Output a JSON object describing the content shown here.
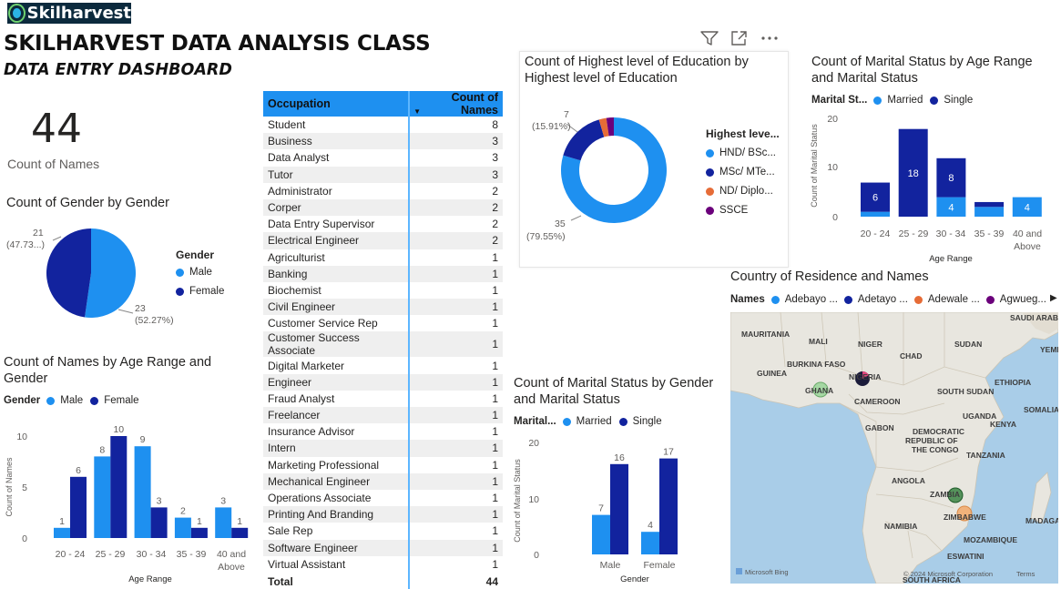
{
  "header": {
    "logo_text": "Skilharvest",
    "title": "SKILHARVEST DATA ANALYSIS CLASS",
    "subtitle": "DATA ENTRY DASHBOARD"
  },
  "colors": {
    "light_blue": "#1e90f0",
    "dark_blue": "#12239e",
    "orange": "#e66c37",
    "purple": "#6b007b",
    "header_blue": "#1e90f0"
  },
  "card": {
    "value": "44",
    "label": "Count of Names"
  },
  "gender_pie": {
    "title": "Count of Gender by Gender",
    "legend_title": "Gender",
    "legend": [
      "Male",
      "Female"
    ],
    "label_female_value": "21",
    "label_female_pct": "(47.73...)",
    "label_male_value": "23",
    "label_male_pct": "(52.27%)"
  },
  "age_gender_chart": {
    "title_line1": "Count of Names by Age Range and",
    "title_line2": "Gender",
    "legend_title": "Gender",
    "legend": [
      "Male",
      "Female"
    ],
    "xlabel": "Age Range",
    "ylabel": "Count of Names",
    "ticks": [
      "0",
      "5",
      "10"
    ],
    "categories": [
      "20 - 24",
      "25 - 29",
      "30 - 34",
      "35 - 39",
      "40 and",
      "Above"
    ]
  },
  "occupation_table": {
    "col1": "Occupation",
    "col2": "Count of Names",
    "rows": [
      [
        "Student",
        "8"
      ],
      [
        "Business",
        "3"
      ],
      [
        "Data Analyst",
        "3"
      ],
      [
        "Tutor",
        "3"
      ],
      [
        "Administrator",
        "2"
      ],
      [
        "Corper",
        "2"
      ],
      [
        "Data Entry Supervisor",
        "2"
      ],
      [
        "Electrical Engineer",
        "2"
      ],
      [
        "Agriculturist",
        "1"
      ],
      [
        "Banking",
        "1"
      ],
      [
        "Biochemist",
        "1"
      ],
      [
        "Civil Engineer",
        "1"
      ],
      [
        "Customer Service Rep",
        "1"
      ],
      [
        "Customer Success Associate",
        "1"
      ],
      [
        "Digital Marketer",
        "1"
      ],
      [
        "Engineer",
        "1"
      ],
      [
        "Fraud Analyst",
        "1"
      ],
      [
        "Freelancer",
        "1"
      ],
      [
        "Insurance Advisor",
        "1"
      ],
      [
        "Intern",
        "1"
      ],
      [
        "Marketing Professional",
        "1"
      ],
      [
        "Mechanical Engineer",
        "1"
      ],
      [
        "Operations Associate",
        "1"
      ],
      [
        "Printing And Branding",
        "1"
      ],
      [
        "Sale Rep",
        "1"
      ],
      [
        "Software Engineer",
        "1"
      ],
      [
        "Virtual Assistant",
        "1"
      ]
    ],
    "total_label": "Total",
    "total_value": "44"
  },
  "education_donut": {
    "title_line1": "Count of Highest level of Education by",
    "title_line2": "Highest level of Education",
    "legend_title": "Highest leve...",
    "legend": [
      "HND/ BSc...",
      "MSc/ MTe...",
      "ND/ Diplo...",
      "SSCE"
    ],
    "label_top_value": "7",
    "label_top_pct": "(15.91%)",
    "label_bottom_value": "35",
    "label_bottom_pct": "(79.55%)"
  },
  "marital_age_chart": {
    "title_line1": "Count of Marital Status by Age Range",
    "title_line2": "and Marital Status",
    "legend_title": "Marital St...",
    "legend": [
      "Married",
      "Single"
    ],
    "xlabel": "Age Range",
    "ylabel": "Count of Marital Status",
    "ticks": [
      "0",
      "10",
      "20"
    ],
    "categories": [
      "20 - 24",
      "25 - 29",
      "30 - 34",
      "35 - 39",
      "40 and",
      "Above"
    ]
  },
  "marital_gender_chart": {
    "title_line1": "Count of Marital Status by Gender",
    "title_line2": "and Marital Status",
    "legend_title": "Marital...",
    "legend": [
      "Married",
      "Single"
    ],
    "xlabel": "Gender",
    "ylabel": "Count of Marital Status",
    "ticks": [
      "0",
      "10",
      "20"
    ],
    "categories": [
      "Male",
      "Female"
    ]
  },
  "map": {
    "title": "Country of Residence and Names",
    "legend_title": "Names",
    "legend": [
      "Adebayo ...",
      "Adetayo ...",
      "Adewale ...",
      "Agwueg..."
    ],
    "countries": [
      "MAURITANIA",
      "MALI",
      "NIGER",
      "CHAD",
      "SUDAN",
      "SAUDI ARAB",
      "YEMEN",
      "BURKINA FASO",
      "GUINEA",
      "GHANA",
      "NIGERIA",
      "CAMEROON",
      "SOUTH SUDAN",
      "ETHIOPIA",
      "SOMALIA",
      "UGANDA",
      "KENYA",
      "GABON",
      "DEMOCRATIC",
      "REPUBLIC OF",
      "THE CONGO",
      "TANZANIA",
      "ANGOLA",
      "ZAMBIA",
      "ZIMBABWE",
      "NAMIBIA",
      "MOZAMBIQUE",
      "MADAGASC",
      "ESWATINI",
      "SOUTH AFRICA"
    ],
    "attribution": "Microsoft Bing",
    "copyright": "© 2024 Microsoft Corporation",
    "terms": "Terms"
  },
  "chart_data": [
    {
      "type": "pie",
      "title": "Count of Gender by Gender",
      "categories": [
        "Male",
        "Female"
      ],
      "values": [
        23,
        21
      ]
    },
    {
      "type": "bar",
      "title": "Count of Names by Age Range and Gender",
      "xlabel": "Age Range",
      "ylabel": "Count of Names",
      "categories": [
        "20 - 24",
        "25 - 29",
        "30 - 34",
        "35 - 39",
        "40 and Above"
      ],
      "series": [
        {
          "name": "Male",
          "values": [
            1,
            8,
            9,
            2,
            3
          ]
        },
        {
          "name": "Female",
          "values": [
            6,
            10,
            3,
            1,
            1
          ]
        }
      ],
      "ylim": [
        0,
        11
      ],
      "legend": "top-left"
    },
    {
      "type": "pie",
      "title": "Count of Highest level of Education by Highest level of Education",
      "categories": [
        "HND/ BSc...",
        "MSc/ MTe...",
        "ND/ Diplo...",
        "SSCE"
      ],
      "values": [
        35,
        7,
        1,
        1
      ]
    },
    {
      "type": "bar",
      "title": "Count of Marital Status by Age Range and Marital Status",
      "xlabel": "Age Range",
      "ylabel": "Count of Marital Status",
      "categories": [
        "20 - 24",
        "25 - 29",
        "30 - 34",
        "35 - 39",
        "40 and Above"
      ],
      "series": [
        {
          "name": "Married",
          "values": [
            1,
            0,
            4,
            2,
            4
          ]
        },
        {
          "name": "Single",
          "values": [
            6,
            18,
            8,
            1,
            0
          ]
        }
      ],
      "stacked": true,
      "ylim": [
        0,
        20
      ],
      "legend": "top-left"
    },
    {
      "type": "bar",
      "title": "Count of Marital Status by Gender and Marital Status",
      "xlabel": "Gender",
      "ylabel": "Count of Marital Status",
      "categories": [
        "Male",
        "Female"
      ],
      "series": [
        {
          "name": "Married",
          "values": [
            7,
            4
          ]
        },
        {
          "name": "Single",
          "values": [
            16,
            17
          ]
        }
      ],
      "ylim": [
        0,
        20
      ],
      "legend": "top-left"
    }
  ]
}
